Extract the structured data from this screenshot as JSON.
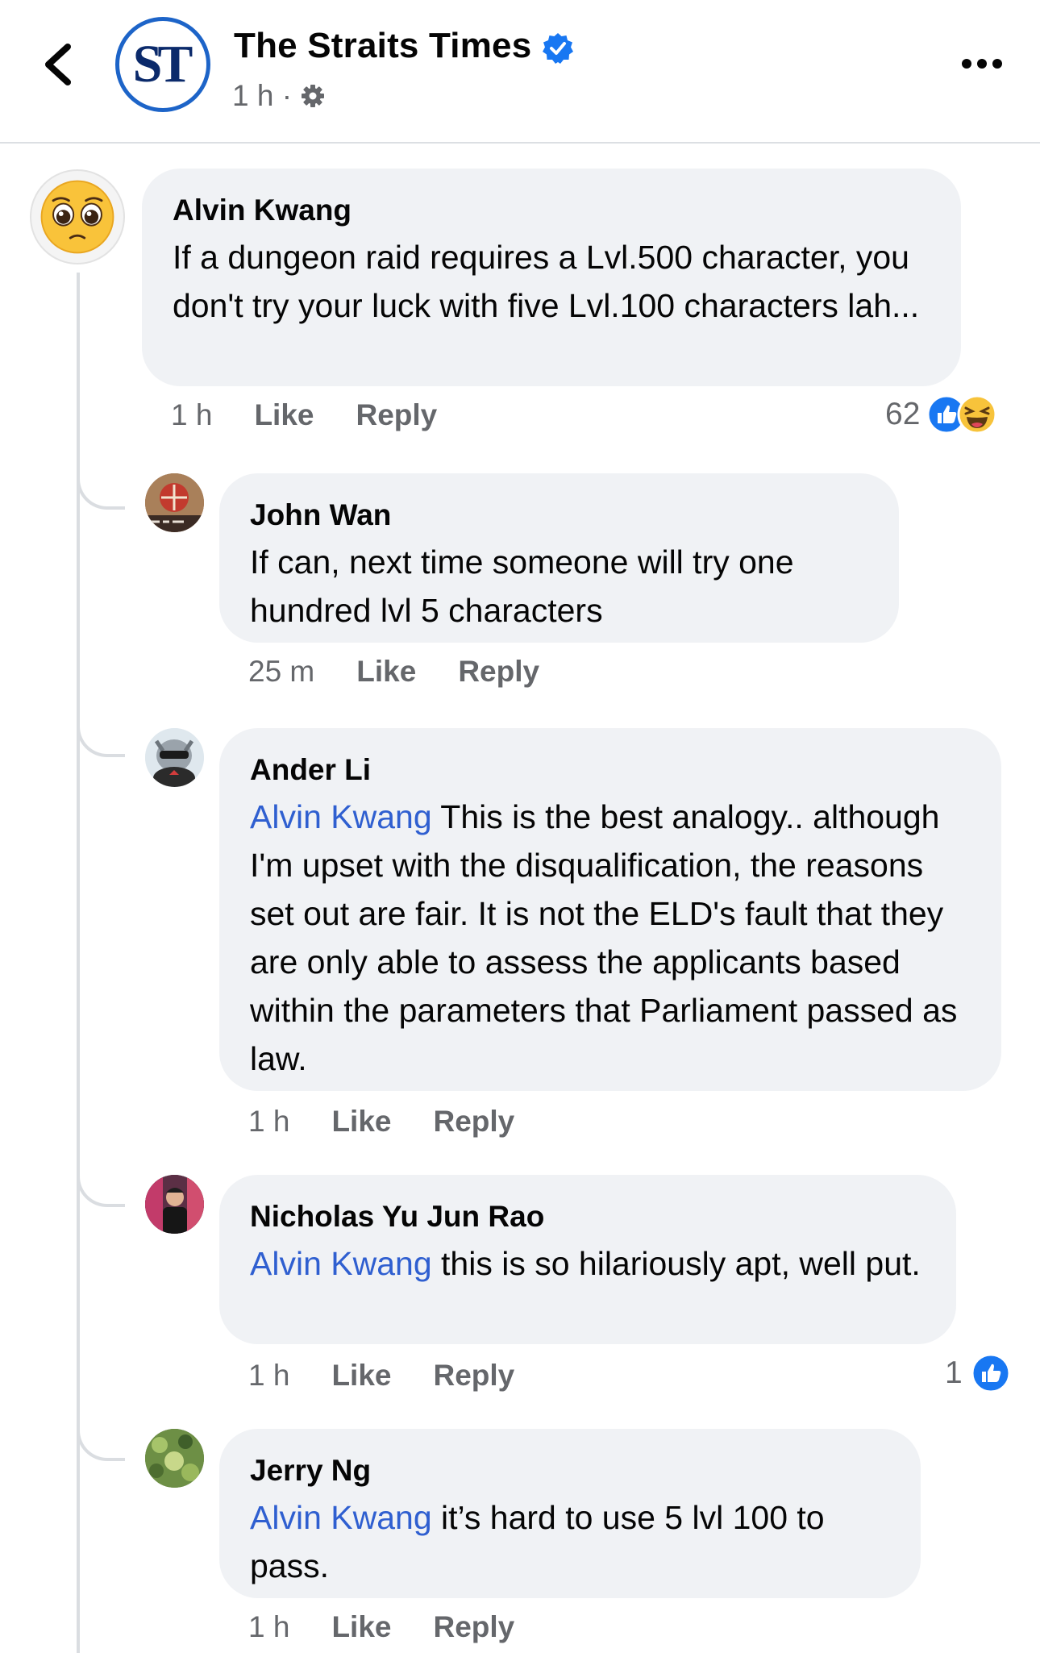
{
  "header": {
    "page_name": "The Straits Times",
    "logo_text": "ST",
    "time": "1 h ·"
  },
  "comments": [
    {
      "author": "Alvin Kwang",
      "text": "If a dungeon raid requires a Lvl.500 character, you don't try your luck with five Lvl.100 characters lah...",
      "time": "1 h",
      "like": "Like",
      "reply": "Reply",
      "reaction_count": "62"
    },
    {
      "author": "John Wan",
      "text": "If can, next time someone will try one hundred lvl 5 characters",
      "time": "25 m",
      "like": "Like",
      "reply": "Reply"
    },
    {
      "author": "Ander Li",
      "mention": "Alvin Kwang",
      "text": " This is the best analogy.. although I'm upset with the disqualification, the reasons set out are fair. It is not the ELD's fault that they are only able to assess the applicants based within the parameters that Parliament passed as law.",
      "time": "1 h",
      "like": "Like",
      "reply": "Reply"
    },
    {
      "author": "Nicholas Yu Jun Rao",
      "mention": "Alvin Kwang",
      "text": " this is so hilariously apt, well put.",
      "time": "1 h",
      "like": "Like",
      "reply": "Reply",
      "reaction_count": "1"
    },
    {
      "author": "Jerry Ng",
      "mention": "Alvin Kwang",
      "text": " it’s hard to use 5 lvl 100 to pass.",
      "time": "1 h",
      "like": "Like",
      "reply": "Reply"
    }
  ],
  "icons": [
    "back-arrow-icon",
    "verified-badge-icon",
    "gear-icon",
    "more-options-icon",
    "like-reaction-icon",
    "haha-reaction-icon"
  ],
  "colors": {
    "accent": "#1877f2",
    "mention": "#2f5fd0",
    "bubble": "#f0f2f5",
    "meta": "#65676b"
  }
}
